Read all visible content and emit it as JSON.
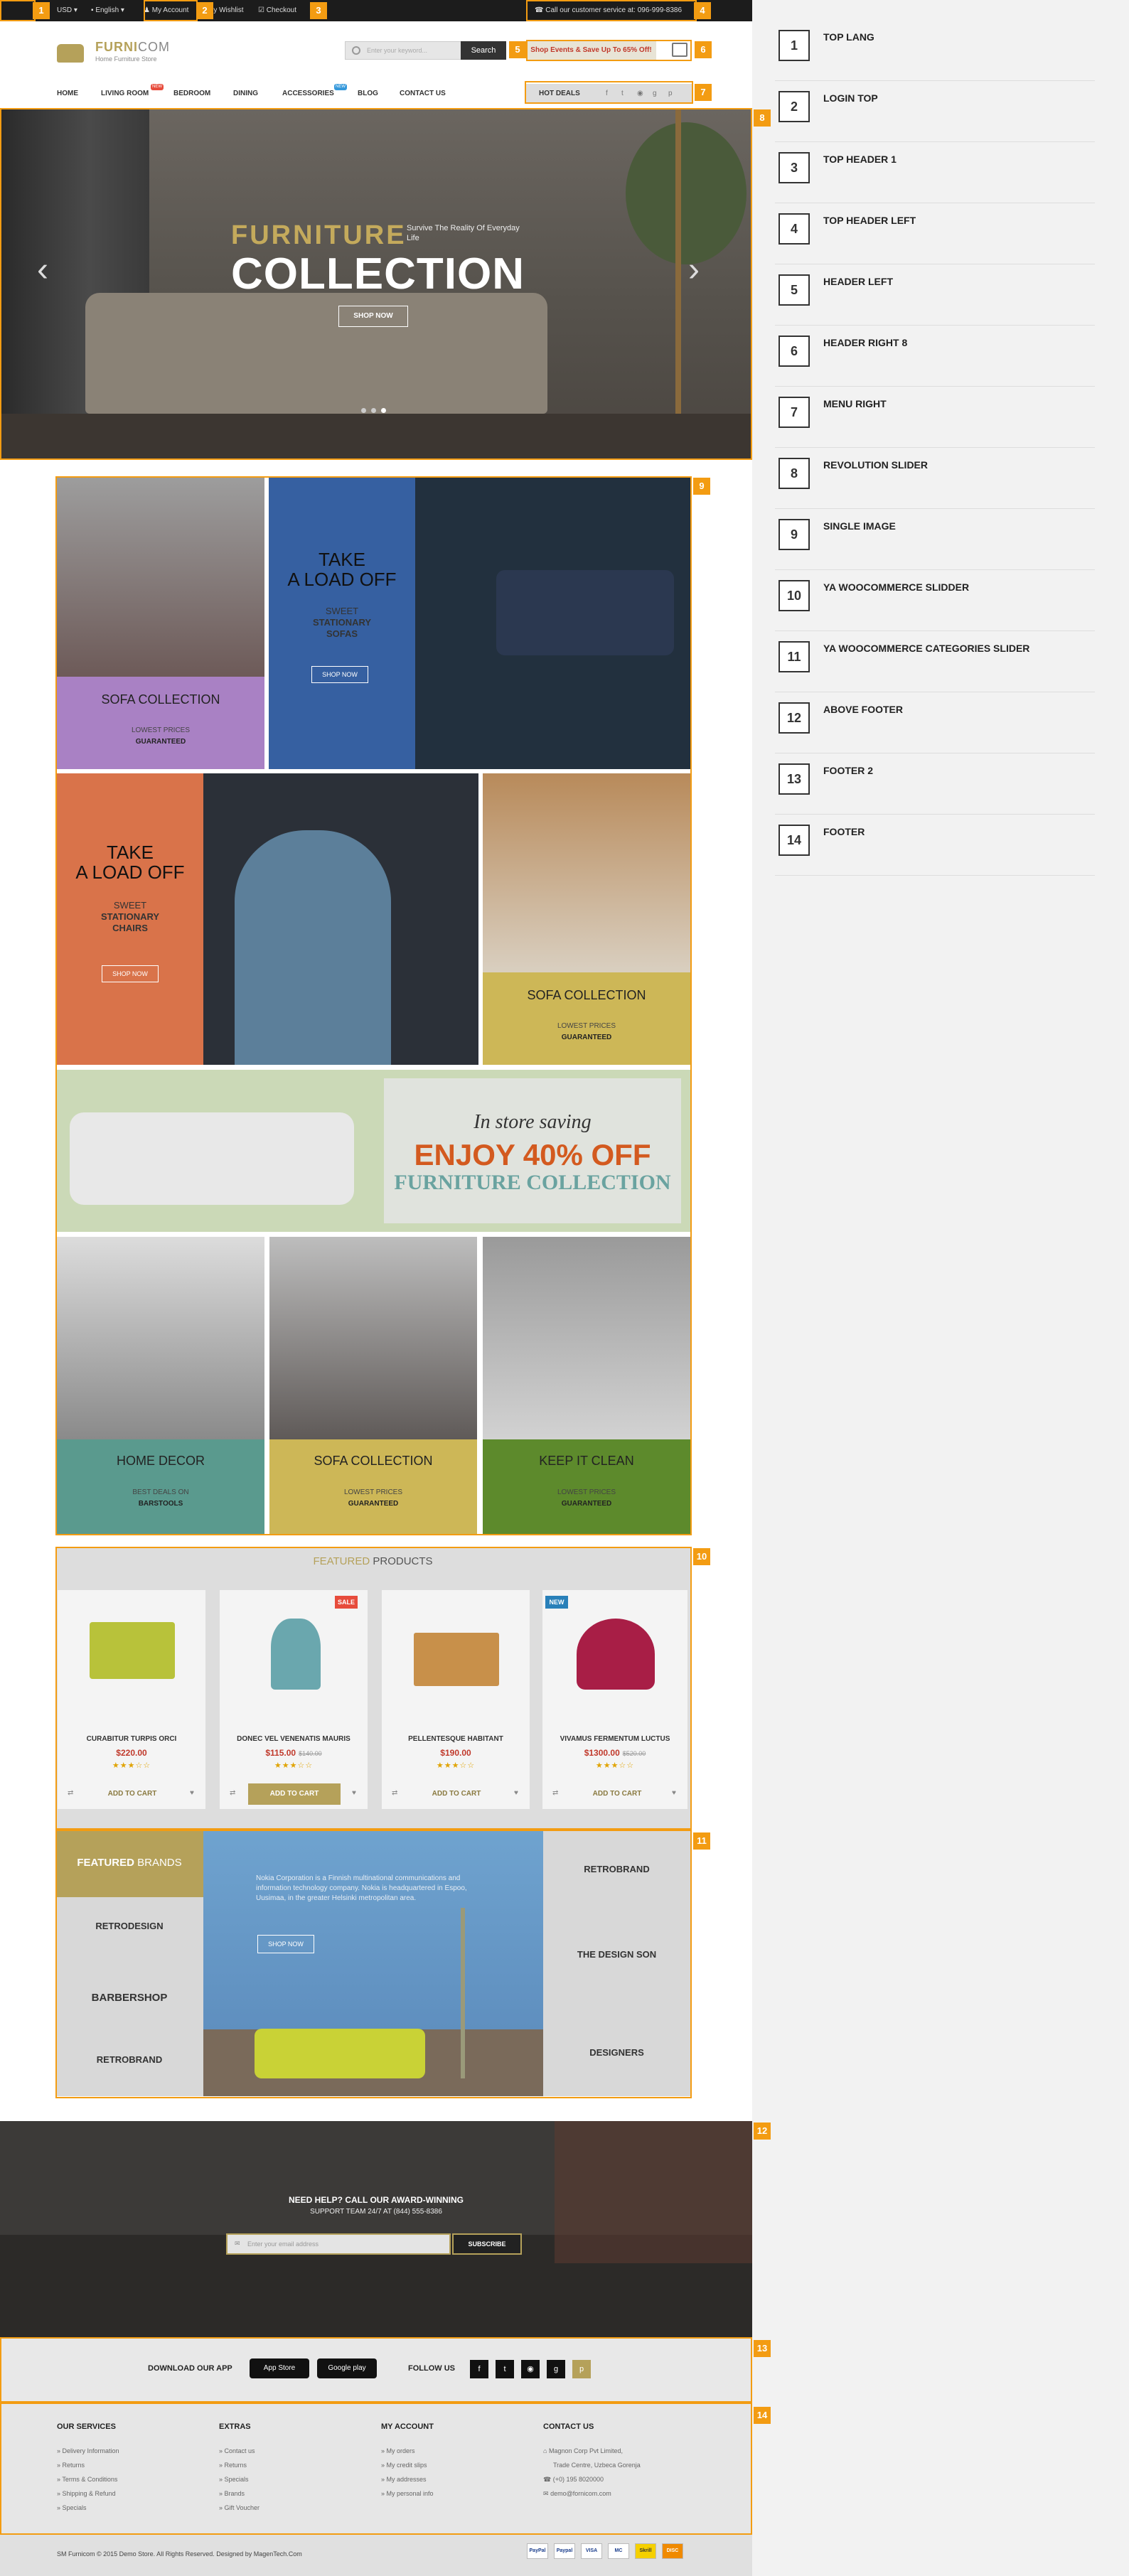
{
  "topbar": {
    "currency": "USD",
    "language": "English",
    "account": "My Account",
    "wishlist": "My Wishlist",
    "checkout": "Checkout",
    "phone": "Call our customer service at: 096-999-8386"
  },
  "header": {
    "logo_main": "FURNI",
    "logo_accent": "COM",
    "tagline": "Home Furniture Store",
    "search_placeholder": "Enter your keyword...",
    "search_button": "Search",
    "promo": "Shop Events & Save Up To 65% Off!"
  },
  "nav": {
    "items": [
      "HOME",
      "LIVING ROOM",
      "BEDROOM",
      "DINING",
      "ACCESSORIES",
      "BLOG",
      "CONTACT US"
    ],
    "hot_deals": "HOT DEALS",
    "new_badge": "NEW"
  },
  "hero": {
    "title_line1": "FURNITURE",
    "title_line2": "COLLECTION",
    "subtitle": "Survive The Reality Of Everyday Life",
    "button": "SHOP NOW"
  },
  "tiles": {
    "t1": {
      "title": "SOFA COLLECTION",
      "line1": "LOWEST PRICES",
      "line2": "GUARANTEED"
    },
    "t2": {
      "title1": "TAKE",
      "title2": "A LOAD OFF",
      "l1": "SWEET",
      "l2": "STATIONARY",
      "l3": "SOFAS",
      "button": "SHOP NOW"
    },
    "t3": {
      "title1": "TAKE",
      "title2": "A LOAD OFF",
      "l1": "SWEET",
      "l2": "STATIONARY",
      "l3": "CHAIRS",
      "button": "SHOP NOW"
    },
    "t4": {
      "title": "SOFA COLLECTION",
      "line1": "LOWEST PRICES",
      "line2": "GUARANTEED"
    },
    "banner": {
      "line1": "In store saving",
      "line2": "ENJOY 40% OFF",
      "line3": "FURNITURE COLLECTION"
    },
    "t5": {
      "title": "HOME DECOR",
      "line1": "BEST DEALS ON",
      "line2": "BARSTOOLS"
    },
    "t6": {
      "title": "SOFA COLLECTION",
      "line1": "LOWEST PRICES",
      "line2": "GUARANTEED"
    },
    "t7": {
      "title": "KEEP IT CLEAN",
      "line1": "LOWEST PRICES",
      "line2": "GUARANTEED"
    }
  },
  "featured": {
    "title_a": "FEATURED",
    "title_b": "PRODUCTS",
    "add_label": "ADD TO CART",
    "products": [
      {
        "name": "CURABITUR TURPIS ORCI",
        "price": "$220.00",
        "old": "",
        "tag": "",
        "stars": "★★★☆☆"
      },
      {
        "name": "DONEC VEL VENENATIS MAURIS",
        "price": "$115.00",
        "old": "$140.00",
        "tag": "SALE",
        "stars": "★★★☆☆"
      },
      {
        "name": "PELLENTESQUE HABITANT",
        "price": "$190.00",
        "old": "",
        "tag": "",
        "stars": "★★★☆☆"
      },
      {
        "name": "VIVAMUS FERMENTUM LUCTUS",
        "price": "$1300.00",
        "old": "$520.00",
        "tag": "NEW",
        "stars": "★★★☆☆"
      }
    ]
  },
  "brands": {
    "title_a": "FEATURED",
    "title_b": "BRANDS",
    "text": "Nokia Corporation is a Finnish multinational communications and information technology company. Nokia is headquartered in Espoo, Uusimaa, in the greater Helsinki metropolitan area.",
    "button": "SHOP NOW",
    "left": [
      "RETRODESIGN",
      "BARBERSHOP",
      "RETROBRAND"
    ],
    "right": [
      "RETROBRAND",
      "THE DESIGN SON",
      "DESIGNERS"
    ]
  },
  "newsletter": {
    "line1": "NEED HELP? CALL OUR AWARD-WINNING",
    "line2": "SUPPORT TEAM 24/7 AT (844) 555-8386",
    "placeholder": "Enter your email address",
    "button": "SUBSCRIBE"
  },
  "footer2": {
    "download": "DOWNLOAD OUR APP",
    "appstore": "App Store",
    "googleplay": "Google play",
    "follow": "FOLLOW US"
  },
  "footer": {
    "cols": [
      {
        "title": "OUR SERVICES",
        "items": [
          "Delivery Information",
          "Returns",
          "Terms & Conditions",
          "Shipping & Refund",
          "Specials"
        ]
      },
      {
        "title": "EXTRAS",
        "items": [
          "Contact us",
          "Returns",
          "Specials",
          "Brands",
          "Gift Voucher"
        ]
      },
      {
        "title": "MY ACCOUNT",
        "items": [
          "My orders",
          "My credit slips",
          "My addresses",
          "My personal info"
        ]
      },
      {
        "title": "CONTACT US",
        "items": [
          "Magnon Corp Pvt Limited,",
          "Trade Centre, Uzbeca Gorenja",
          "(+0) 195 8020000",
          "demo@fornicom.com"
        ]
      }
    ],
    "copyright": "SM Furnicom © 2015 Demo Store. All Rights Reserved. Designed by MagenTech.Com",
    "payments": [
      "PayPal",
      "Paypal",
      "VISA",
      "MC",
      "Skrill",
      "DISC"
    ]
  },
  "sidebar": [
    {
      "num": "1",
      "label": "TOP LANG"
    },
    {
      "num": "2",
      "label": "LOGIN TOP"
    },
    {
      "num": "3",
      "label": "TOP HEADER 1"
    },
    {
      "num": "4",
      "label": "TOP HEADER LEFT"
    },
    {
      "num": "5",
      "label": "HEADER LEFT"
    },
    {
      "num": "6",
      "label": "HEADER RIGHT 8"
    },
    {
      "num": "7",
      "label": "MENU RIGHT"
    },
    {
      "num": "8",
      "label": "REVOLUTION SLIDER"
    },
    {
      "num": "9",
      "label": "SINGLE IMAGE"
    },
    {
      "num": "10",
      "label": "YA WOOCOMMERCE SLIDDER"
    },
    {
      "num": "11",
      "label": "YA WOOCOMMERCE CATEGORIES SLIDER"
    },
    {
      "num": "12",
      "label": "ABOVE FOOTER"
    },
    {
      "num": "13",
      "label": "FOOTER 2"
    },
    {
      "num": "14",
      "label": "FOOTER"
    }
  ]
}
